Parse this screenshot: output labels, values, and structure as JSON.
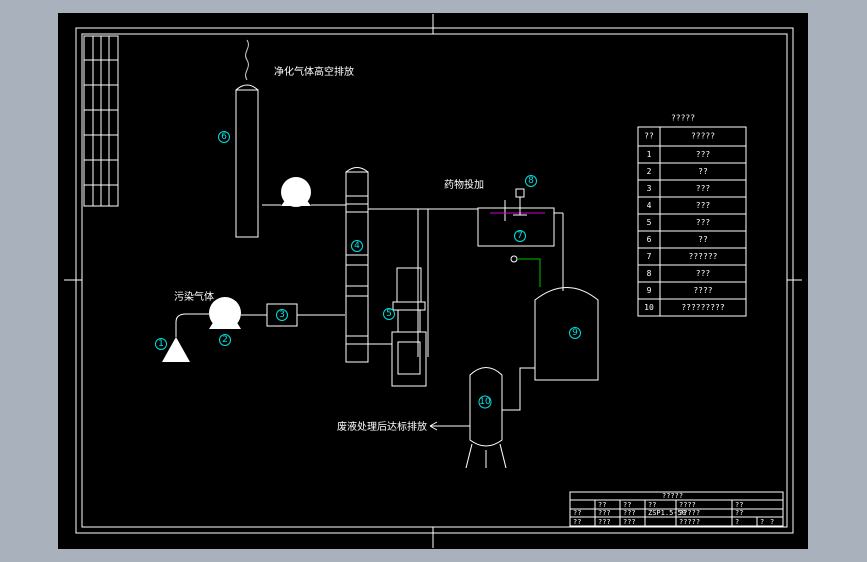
{
  "labels": {
    "exhaust": "净化气体高空排放",
    "dosing": "药物投加",
    "polluted_gas": "污染气体",
    "wastewater": "废液处理后达标排放"
  },
  "markers": [
    "1",
    "2",
    "3",
    "4",
    "5",
    "6",
    "7",
    "8",
    "9",
    "10"
  ],
  "parts_table": {
    "title": "?????",
    "header": [
      "??",
      "?????"
    ],
    "rows": [
      [
        "1",
        "???"
      ],
      [
        "2",
        "??"
      ],
      [
        "3",
        "???"
      ],
      [
        "4",
        "???"
      ],
      [
        "5",
        "???"
      ],
      [
        "6",
        "??"
      ],
      [
        "7",
        "??????"
      ],
      [
        "8",
        "???"
      ],
      [
        "9",
        "????"
      ],
      [
        "10",
        "?????????"
      ]
    ]
  },
  "title_block": {
    "row1": [
      "?????"
    ],
    "row2": [
      "??",
      "??",
      "??",
      "????",
      "??"
    ],
    "row3": [
      "??",
      "???",
      "???",
      "ZSP1.5-50",
      "?????",
      "??"
    ],
    "row4": [
      "??",
      "???",
      "???",
      "",
      "?????",
      "?",
      "?",
      "?"
    ]
  }
}
